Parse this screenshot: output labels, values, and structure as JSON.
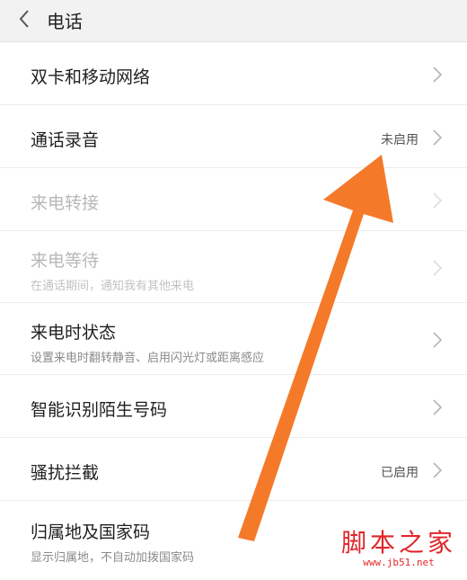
{
  "header": {
    "title": "电话",
    "back_icon": "chevron-left-icon"
  },
  "items": [
    {
      "title": "双卡和移动网络",
      "subtitle": "",
      "status": "",
      "disabled": false
    },
    {
      "title": "通话录音",
      "subtitle": "",
      "status": "未启用",
      "disabled": false
    },
    {
      "title": "来电转接",
      "subtitle": "",
      "status": "",
      "disabled": true
    },
    {
      "title": "来电等待",
      "subtitle": "在通话期间，通知我有其他来电",
      "status": "",
      "disabled": true
    },
    {
      "title": "来电时状态",
      "subtitle": "设置来电时翻转静音、启用闪光灯或距离感应",
      "status": "",
      "disabled": false
    },
    {
      "title": "智能识别陌生号码",
      "subtitle": "",
      "status": "",
      "disabled": false
    },
    {
      "title": "骚扰拦截",
      "subtitle": "",
      "status": "已启用",
      "disabled": false
    },
    {
      "title": "归属地及国家码",
      "subtitle": "显示归属地，不自动加拨国家码",
      "status": "",
      "disabled": false
    }
  ],
  "annotation": {
    "arrow_color": "#f47a2a"
  },
  "watermark": {
    "main": "脚本之家",
    "url": "www.jb51.net",
    "color": "#e0262a"
  }
}
